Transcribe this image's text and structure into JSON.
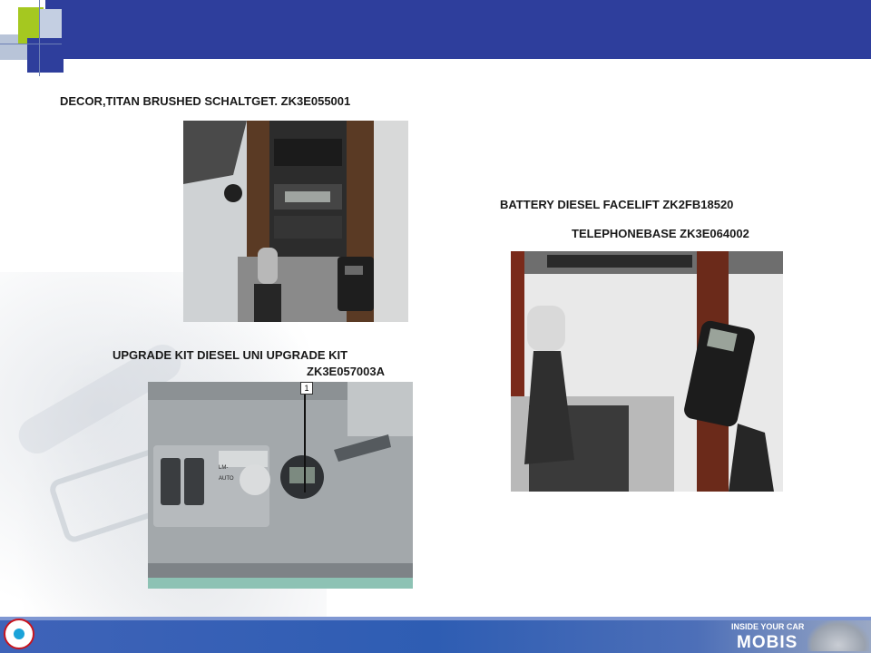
{
  "slide": {
    "labels": {
      "decor": "DECOR,TITAN BRUSHED SCHALTGET. ZK3E055001",
      "battery": "BATTERY DIESEL FACELIFT ZK2FB18520",
      "telephone": "TELEPHONEBASE ZK3E064002",
      "upgrade_line1": "UPGRADE KIT DIESEL UNI UPGRADE KIT",
      "upgrade_line2": "ZK3E057003A"
    },
    "panel_photo": {
      "callout_number": "1",
      "switch_text_1": "LM-",
      "switch_text_2": "AUTO"
    }
  },
  "footer": {
    "brand_tagline": "INSIDE YOUR CAR",
    "brand_name": "MOBIS"
  },
  "colors": {
    "header_blue": "#2e3e9c",
    "accent_green": "#a5c820",
    "footer_blue": "#2e5db3",
    "logo_red": "#c8141e"
  }
}
